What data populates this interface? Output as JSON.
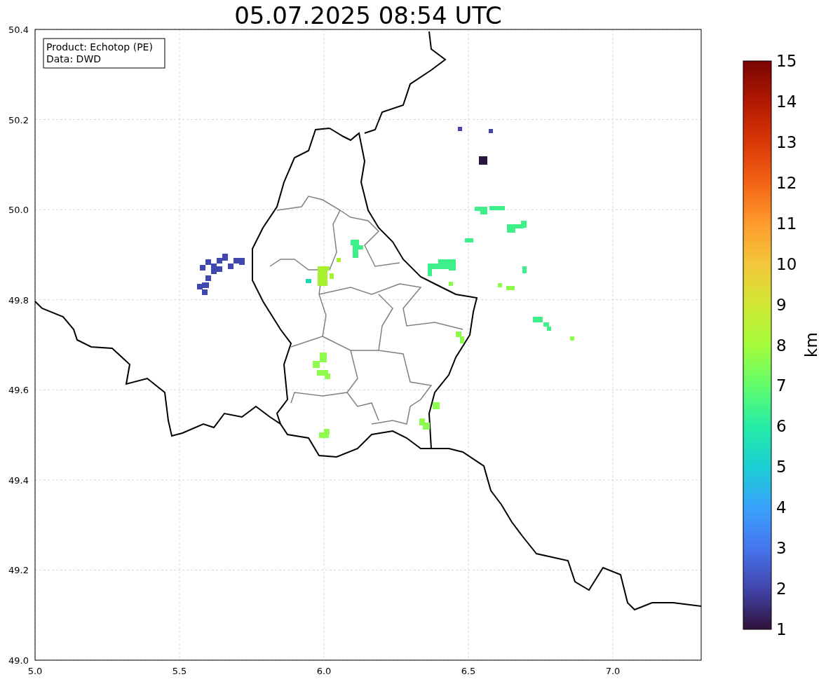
{
  "title": "05.07.2025 08:54 UTC",
  "info": [
    "Product: Echotop (PE)",
    "Data: DWD"
  ],
  "map": {
    "xticks": [
      "5.0",
      "5.5",
      "6.0",
      "6.5",
      "7.0"
    ],
    "yticks": [
      "50.4",
      "50.2",
      "50.0",
      "49.8",
      "49.6",
      "49.4",
      "49.2",
      "49.0"
    ]
  },
  "colorbar": {
    "label": "km",
    "ticks": [
      "15",
      "14",
      "13",
      "12",
      "11",
      "10",
      "9",
      "8",
      "7",
      "6",
      "5",
      "4",
      "3",
      "2",
      "1"
    ]
  }
}
